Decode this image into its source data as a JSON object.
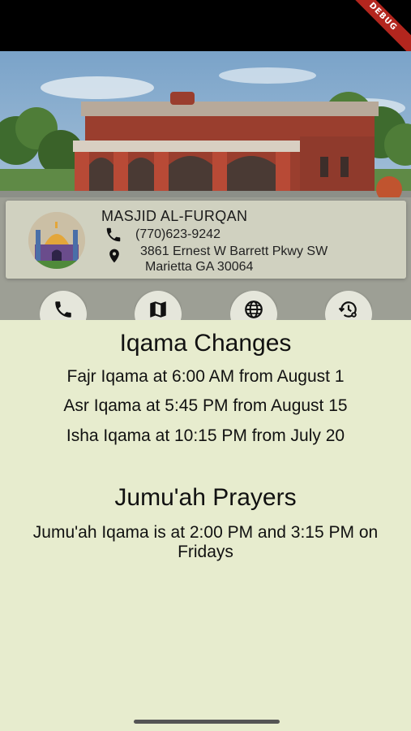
{
  "debug_banner": "DEBUG",
  "masjid": {
    "name": "MASJID AL-FURQAN",
    "phone": "(770)623-9242",
    "address_line1": "3861 Ernest W Barrett Pkwy SW",
    "address_line2": "Marietta GA 30064"
  },
  "actions": [
    {
      "name": "call",
      "icon": "phone-icon"
    },
    {
      "name": "map",
      "icon": "map-icon"
    },
    {
      "name": "website",
      "icon": "globe-icon"
    },
    {
      "name": "timings",
      "icon": "history-settings-icon"
    }
  ],
  "iqama_changes": {
    "title": "Iqama Changes",
    "items": [
      "Fajr Iqama at 6:00 AM from August 1",
      "Asr Iqama at 5:45 PM from August 15",
      "Isha Iqama at 10:15 PM from July 20"
    ]
  },
  "jumuah": {
    "title": "Jumu'ah Prayers",
    "text": "Jumu'ah Iqama is at 2:00 PM and 3:15 PM on Fridays"
  },
  "colors": {
    "background": "#e7ecce",
    "status_bar": "#000000",
    "debug_ribbon": "#b3261e"
  }
}
